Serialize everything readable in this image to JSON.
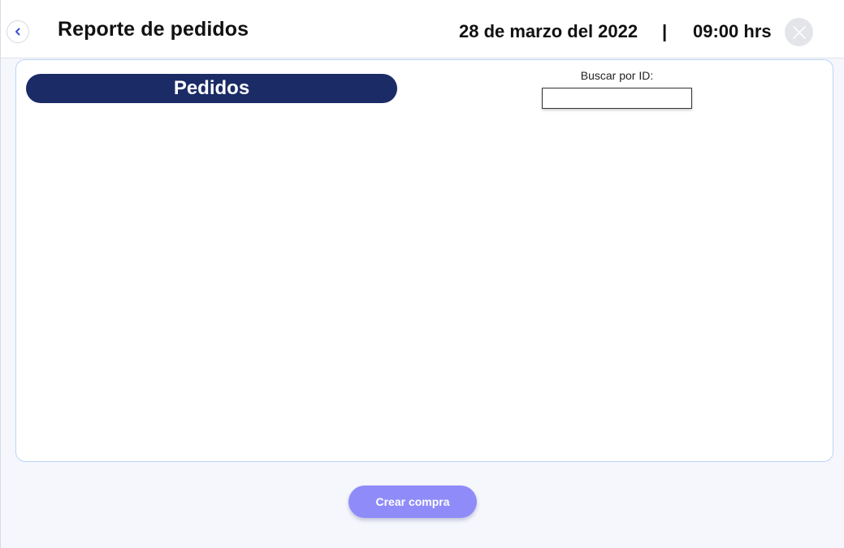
{
  "header": {
    "title": "Reporte de pedidos",
    "date": "28 de marzo del 2022",
    "separator": "|",
    "time": "09:00 hrs",
    "back_icon": "chevron-left-icon",
    "close_icon": "close-icon"
  },
  "panel": {
    "section_title": "Pedidos",
    "search": {
      "label": "Buscar por ID:",
      "value": "",
      "placeholder": ""
    }
  },
  "footer": {
    "create_label": "Crear compra"
  },
  "colors": {
    "accent_navy": "#1b2b66",
    "button_purple": "#8f8cf9",
    "back_chevron": "#3b4fd8",
    "background": "#f5f7fd"
  }
}
